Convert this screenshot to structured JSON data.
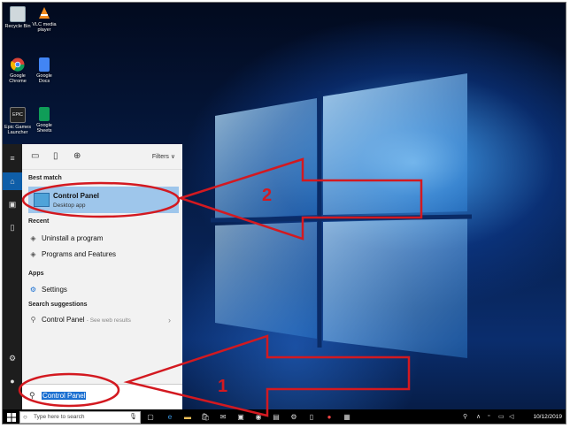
{
  "desktop": {
    "icons": [
      {
        "label": "Recycle Bin",
        "icon": "recycle-bin-icon"
      },
      {
        "label": "VLC media player",
        "icon": "vlc-icon"
      },
      {
        "label": "Google Chrome",
        "icon": "chrome-icon"
      },
      {
        "label": "Google Docs",
        "icon": "docs-icon"
      },
      {
        "label": "Epic Games Launcher",
        "icon": "epic-games-icon"
      },
      {
        "label": "Google Sheets",
        "icon": "sheets-icon"
      }
    ]
  },
  "start_menu": {
    "tabs": [
      "all-icon",
      "documents-icon",
      "web-icon"
    ],
    "filters_label": "Filters",
    "best_match": {
      "section": "Best match",
      "name": "Control Panel",
      "subtitle": "Desktop app"
    },
    "recent": {
      "section": "Recent",
      "items": [
        "Uninstall a program",
        "Programs and Features"
      ]
    },
    "apps": {
      "section": "Apps",
      "items": [
        "Settings"
      ]
    },
    "suggestions": {
      "section": "Search suggestions",
      "query": "Control Panel",
      "hint": "- See web results"
    },
    "search_value": "Control Panel"
  },
  "taskbar": {
    "search_placeholder": "Type here to search",
    "clock": "10/12/2019"
  },
  "annotations": {
    "step1": "1",
    "step2": "2",
    "accent": "#d31920"
  }
}
